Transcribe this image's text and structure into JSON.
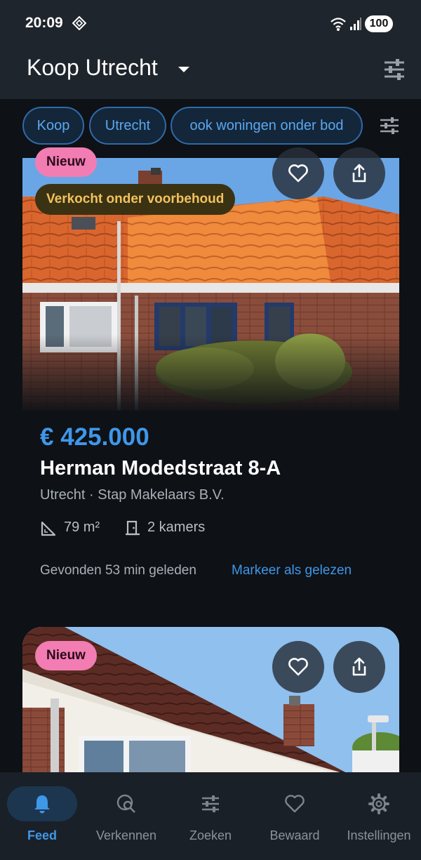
{
  "status": {
    "time": "20:09",
    "battery": "100",
    "wifi_icon": "wifi-icon",
    "signal_icon": "signal-icon"
  },
  "app_bar": {
    "title": "Koop Utrecht",
    "dropdown_icon": "caret-down-icon",
    "filter_icon": "sliders-icon"
  },
  "chips": [
    "Koop",
    "Utrecht",
    "ook woningen onder bod"
  ],
  "listing": {
    "badge_new": "Nieuw",
    "badge_status": "Verkocht onder voorbehoud",
    "price": "€ 425.000",
    "address": "Herman Modedstraat 8-A",
    "subline": "Utrecht · Stap Makelaars B.V.",
    "area": "79 m²",
    "rooms": "2 kamers",
    "found": "Gevonden 53 min geleden",
    "mark_read": "Markeer als gelezen"
  },
  "listing2": {
    "badge_new": "Nieuw"
  },
  "nav": [
    {
      "label": "Feed",
      "icon": "bell-icon",
      "active": true
    },
    {
      "label": "Verkennen",
      "icon": "explore-icon",
      "active": false
    },
    {
      "label": "Zoeken",
      "icon": "sliders-icon",
      "active": false
    },
    {
      "label": "Bewaard",
      "icon": "heart-icon",
      "active": false
    },
    {
      "label": "Instellingen",
      "icon": "gear-icon",
      "active": false
    }
  ],
  "colors": {
    "accent": "#3f97e8",
    "new_badge": "#f27db2",
    "status_badge_text": "#f2c25d",
    "background": "#0e1116"
  }
}
